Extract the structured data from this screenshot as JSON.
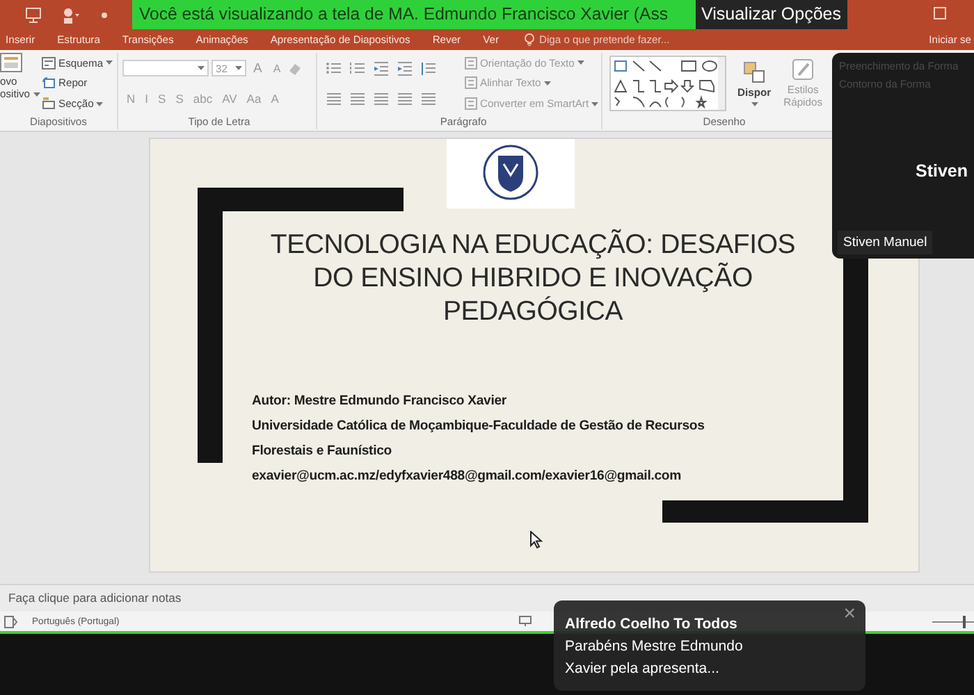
{
  "title_bar": {
    "share_banner": "Você está visualizando a tela de MA. Edmundo Francisco Xavier (Ass",
    "options_button": "Visualizar Opções"
  },
  "ribbon_tabs": [
    {
      "label": "Inserir"
    },
    {
      "label": "Estrutura"
    },
    {
      "label": "Transições"
    },
    {
      "label": "Animações"
    },
    {
      "label": "Apresentação de Diapositivos"
    },
    {
      "label": "Rever"
    },
    {
      "label": "Ver"
    }
  ],
  "tell_me": {
    "placeholder": "Diga o que pretende fazer..."
  },
  "ribbon_right": "Iniciar se",
  "ribbon": {
    "slides_group": {
      "label": "Diapositivos",
      "new_slide": [
        "ovo",
        "ositivo"
      ],
      "items": [
        "Esquema",
        "Repor",
        "Secção"
      ]
    },
    "font_group": {
      "label": "Tipo de Letra",
      "font_size": "32",
      "size_buttons": [
        "A",
        "A"
      ],
      "format_buttons": [
        "N",
        "I",
        "S",
        "S",
        "abc",
        "AV",
        "Aa",
        "A"
      ]
    },
    "paragraph_group": {
      "label": "Parágrafo",
      "items": [
        "Orientação do Texto",
        "Alinhar Texto",
        "Converter em SmartArt"
      ]
    },
    "drawing_group": {
      "label": "Desenho",
      "arrange": "Dispor",
      "quick_styles": "Estilos Rápidos",
      "shape_options": [
        "Preenchimento da Forma",
        "Contorno da Forma"
      ]
    }
  },
  "slide": {
    "title": "TECNOLOGIA NA EDUCAÇÃO: DESAFIOS DO ENSINO HIBRIDO E INOVAÇÃO PEDAGÓGICA",
    "lines": [
      "Autor: Mestre Edmundo Francisco Xavier",
      "Universidade Católica de Moçambique-Faculdade de Gestão de Recursos",
      "Florestais e Faunístico",
      "exavier@ucm.ac.mz/edyfxavier488@gmail.com/exavier16@gmail.com"
    ]
  },
  "notes": {
    "text": "Faça clique para adicionar notas"
  },
  "status_bar": {
    "language": "Português (Portugal)",
    "zoom": {
      "level": 0.6
    }
  },
  "video": {
    "name_large": "Stiven",
    "name_tag": "Stiven Manuel"
  },
  "chat_toast": {
    "sender": "Alfredo Coelho To Todos",
    "message": "Parabéns Mestre Edmundo Xavier pela apresenta...",
    "close": "×"
  }
}
